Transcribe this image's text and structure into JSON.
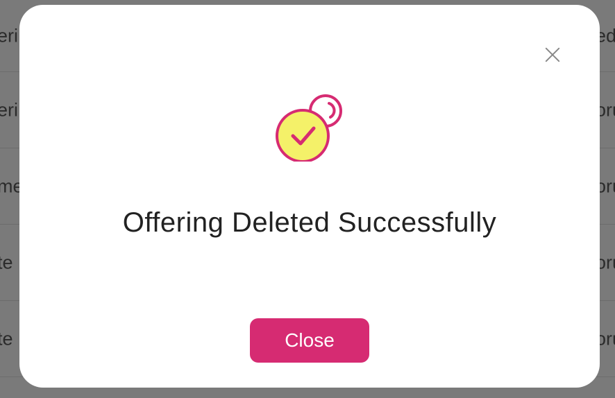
{
  "background_table": {
    "rows": [
      {
        "left": "eri",
        "right": "ed"
      },
      {
        "left": "eri",
        "right": "oru"
      },
      {
        "left": "me",
        "right": "oru"
      },
      {
        "left": " te",
        "right": "oru"
      },
      {
        "left": " te",
        "right": "oru"
      }
    ]
  },
  "modal": {
    "close_icon_name": "close-icon",
    "success_icon_name": "success-check-icon",
    "title": "Offering Deleted Successfully",
    "close_button_label": "Close"
  },
  "colors": {
    "accent": "#d62b72",
    "icon_fill": "#f4f169",
    "overlay": "#7a7a7a"
  }
}
